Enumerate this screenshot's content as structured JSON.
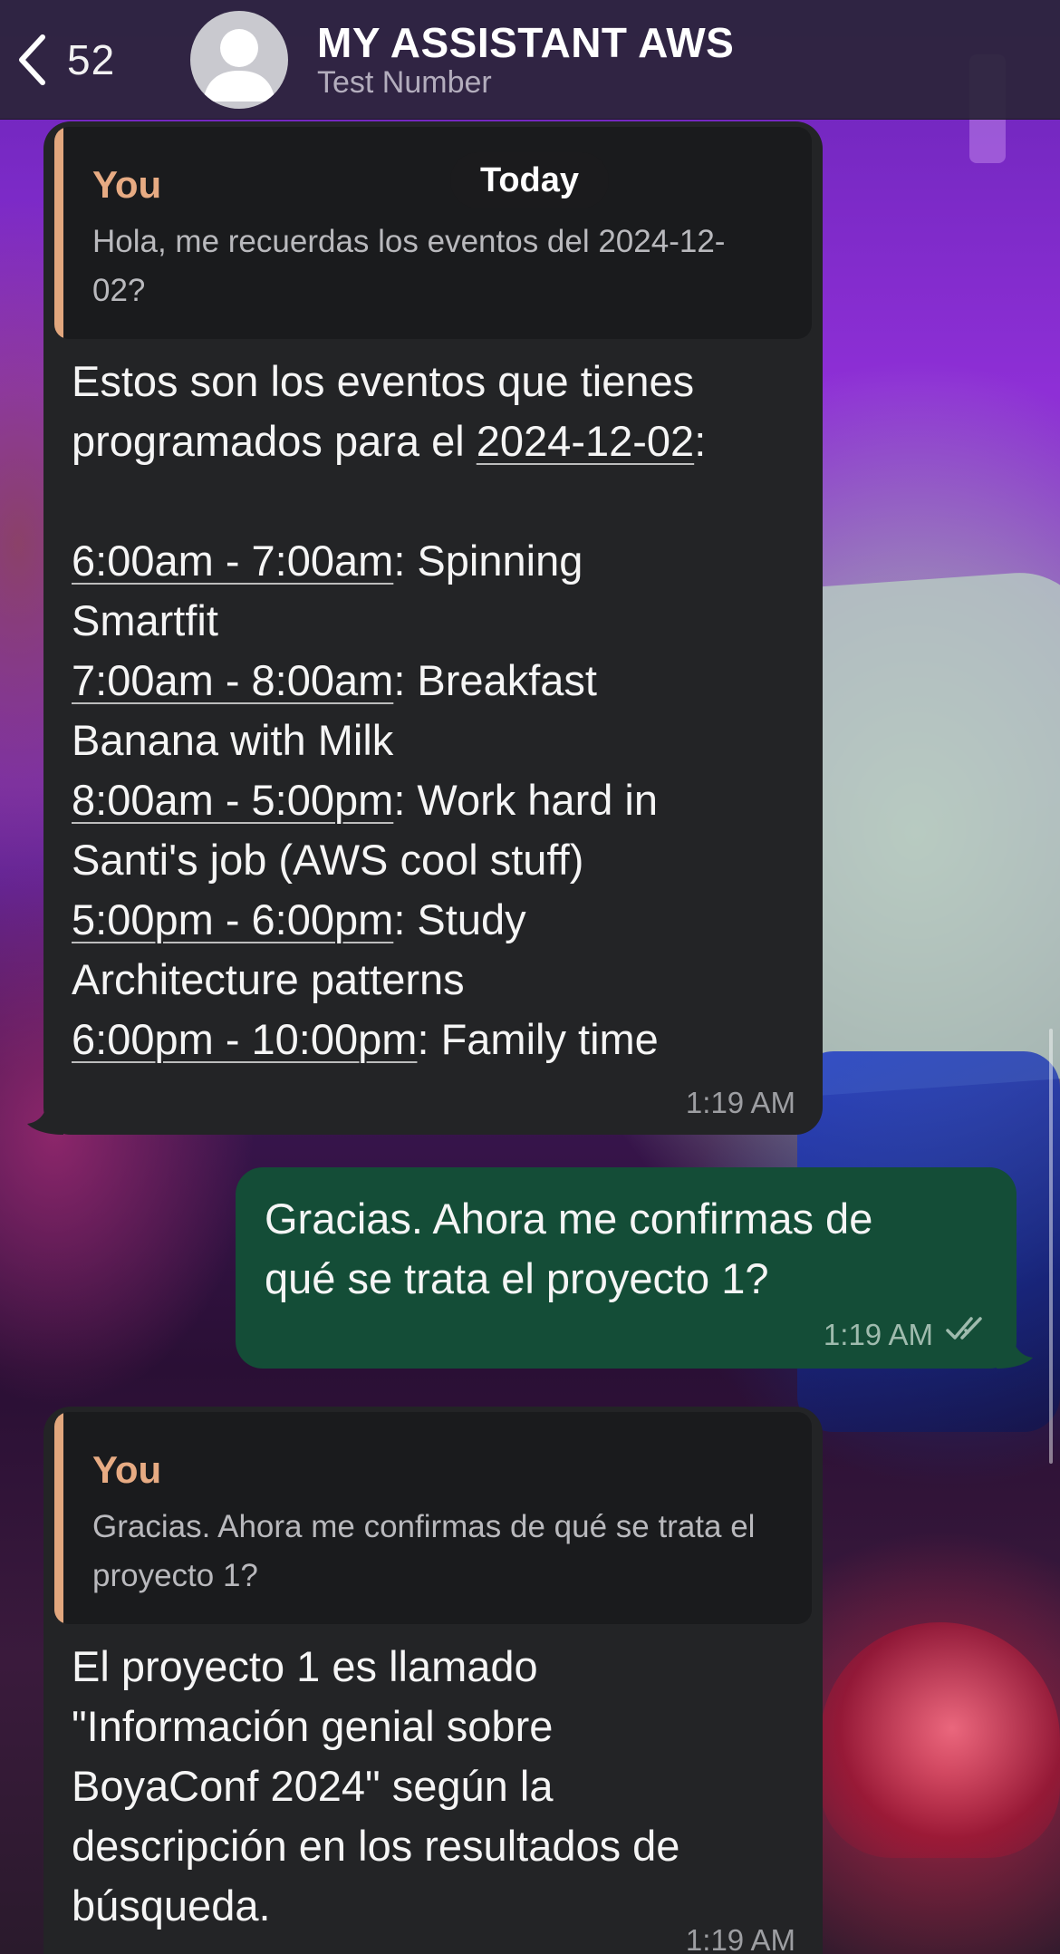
{
  "header": {
    "back_count": "52",
    "title": "MY ASSISTANT AWS",
    "subtitle": "Test Number"
  },
  "date_separator": "Today",
  "messages": [
    {
      "direction": "incoming",
      "quote": {
        "author": "You",
        "text": "Hola, me recuerdas los eventos del 2024-12-02?"
      },
      "intro_1": "Estos son los eventos que tienes",
      "intro_2": "programados para el ",
      "intro_date": "2024-12-02",
      "intro_colon": ":",
      "events": [
        {
          "time": "6:00am - 7:00am",
          "line1": ": Spinning",
          "line2": "Smartfit"
        },
        {
          "time": "7:00am - 8:00am",
          "line1": ": Breakfast",
          "line2": "Banana with Milk"
        },
        {
          "time": "8:00am - 5:00pm",
          "line1": ": Work hard in",
          "line2": "Santi's job (AWS cool stuff)"
        },
        {
          "time": "5:00pm - 6:00pm",
          "line1": ": Study",
          "line2": "Architecture patterns"
        },
        {
          "time": "6:00pm - 10:00pm",
          "line1": ": Family time",
          "line2": ""
        }
      ],
      "timestamp": "1:19 AM"
    },
    {
      "direction": "outgoing",
      "text": "Gracias. Ahora me confirmas de qué se trata el proyecto 1?",
      "line1": "Gracias. Ahora me confirmas de",
      "line2": "qué se trata el proyecto 1?",
      "timestamp": "1:19 AM",
      "status_icon": "double-check-read-icon"
    },
    {
      "direction": "incoming",
      "quote": {
        "author": "You",
        "text": "Gracias. Ahora me confirmas de qué se trata el proyecto 1?"
      },
      "lines": [
        "El proyecto 1 es llamado",
        "\"Información genial sobre",
        "BoyaConf 2024\" según la",
        "descripción en los resultados de",
        "búsqueda."
      ],
      "timestamp": "1:19 AM"
    }
  ],
  "colors": {
    "incoming_bubble": "#232426",
    "outgoing_bubble": "#144d37",
    "quote_accent": "#e2a77e"
  }
}
